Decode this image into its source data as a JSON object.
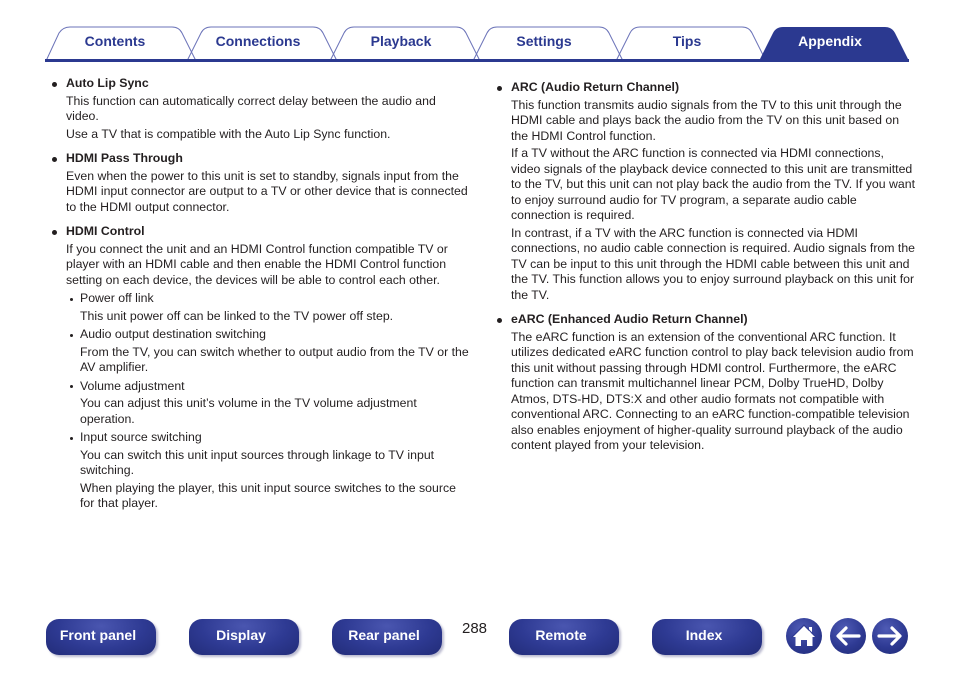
{
  "tabs": [
    {
      "label": "Contents",
      "active": false
    },
    {
      "label": "Connections",
      "active": false
    },
    {
      "label": "Playback",
      "active": false
    },
    {
      "label": "Settings",
      "active": false
    },
    {
      "label": "Tips",
      "active": false
    },
    {
      "label": "Appendix",
      "active": true
    }
  ],
  "colors": {
    "accent": "#2b3990",
    "text": "#231f20",
    "tab_outline": "#6b73b8"
  },
  "left_column": {
    "items": [
      {
        "title": "Auto Lip Sync",
        "paragraphs": [
          "This function can automatically correct delay between the audio and video.",
          "Use a TV that is compatible with the Auto Lip Sync function."
        ]
      },
      {
        "title": "HDMI Pass Through",
        "paragraphs": [
          "Even when the power to this unit is set to standby, signals input from the HDMI input connector are output to a TV or other device that is connected to the HDMI output connector."
        ]
      },
      {
        "title": "HDMI Control",
        "paragraphs": [
          "If you connect the unit and an HDMI Control function compatible TV or player with an HDMI cable and then enable the HDMI Control function setting on each device, the devices will be able to control each other."
        ],
        "subitems": [
          {
            "title": "Power off link",
            "lines": [
              "This unit power off can be linked to the TV power off step."
            ]
          },
          {
            "title": "Audio output destination switching",
            "lines": [
              "From the TV, you can switch whether to output audio from the TV or the AV amplifier."
            ]
          },
          {
            "title": "Volume adjustment",
            "lines": [
              "You can adjust this unit’s volume in the TV volume adjustment operation."
            ]
          },
          {
            "title": "Input source switching",
            "lines": [
              "You can switch this unit input sources through linkage to TV input switching.",
              "When playing the player, this unit input source switches to the source for that player."
            ]
          }
        ]
      }
    ]
  },
  "right_column": {
    "items": [
      {
        "title": "ARC (Audio Return Channel)",
        "paragraphs": [
          "This function transmits audio signals from the TV to this unit through the HDMI cable and plays back the audio from the TV on this unit based on the HDMI Control function.",
          "If a TV without the ARC function is connected via HDMI connections, video signals of the playback device connected to this unit are transmitted to the TV, but this unit can not play back the audio from the TV. If you want to enjoy surround audio for TV program, a separate audio cable connection is required.",
          "In contrast, if a TV with the ARC function is connected via HDMI connections, no audio cable connection is required. Audio signals from the TV can be input to this unit through the HDMI cable between this unit and the TV. This function allows you to enjoy surround playback on this unit for the TV."
        ]
      },
      {
        "title": "eARC (Enhanced Audio Return Channel)",
        "paragraphs": [
          "The eARC function is an extension of the conventional ARC function. It utilizes dedicated eARC function control to play back television audio from this unit without passing through HDMI control. Furthermore, the eARC function can transmit multichannel linear PCM, Dolby TrueHD, Dolby Atmos, DTS-HD, DTS:X and other audio formats not compatible with conventional ARC. Connecting to an eARC function-compatible television also enables enjoyment of higher-quality surround playback of the audio content played from your television."
        ]
      }
    ]
  },
  "footer": {
    "buttons": [
      {
        "label": "Front panel"
      },
      {
        "label": "Display"
      },
      {
        "label": "Rear panel"
      },
      {
        "label": "Remote"
      },
      {
        "label": "Index"
      }
    ],
    "page_number": "288",
    "icons": {
      "home": "home-icon",
      "back": "arrow-left-icon",
      "forward": "arrow-right-icon"
    }
  }
}
